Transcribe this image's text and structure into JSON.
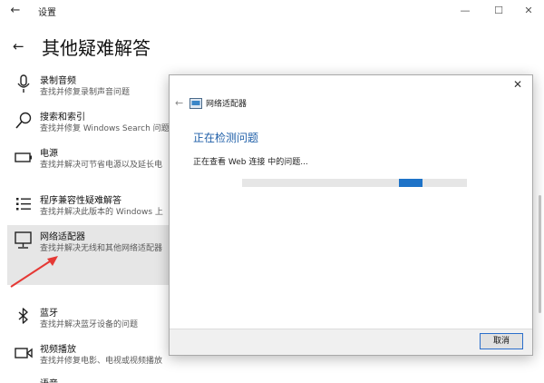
{
  "window": {
    "title": "设置",
    "back_glyph": "←",
    "min_glyph": "—",
    "max_glyph": "☐",
    "close_glyph": "✕"
  },
  "page": {
    "back_glyph": "←",
    "title": "其他疑难解答"
  },
  "tools": [
    {
      "name": "录制音频",
      "desc": "查找并修复录制声音问题",
      "icon": "microphone-icon"
    },
    {
      "name": "搜索和索引",
      "desc": "查找并修复 Windows Search 问题",
      "icon": "search-icon"
    },
    {
      "name": "电源",
      "desc": "查找并解决可节省电源以及延长电",
      "icon": "battery-icon"
    },
    {
      "name": "程序兼容性疑难解答",
      "desc": "查找并解决此版本的 Windows 上",
      "icon": "list-icon"
    },
    {
      "name": "网络适配器",
      "desc": "查找并解决无线和其他网络适配器",
      "icon": "network-adapter-icon"
    },
    {
      "name": "蓝牙",
      "desc": "查找并解决蓝牙设备的问题",
      "icon": "bluetooth-icon"
    },
    {
      "name": "视频播放",
      "desc": "查找并修复电影、电视或视频播放",
      "icon": "video-icon"
    },
    {
      "name": "语音",
      "desc": "",
      "icon": "speech-icon"
    }
  ],
  "dialog": {
    "close_glyph": "✕",
    "back_glyph": "←",
    "title": "网络适配器",
    "heading": "正在检测问题",
    "status": "正在查看 Web 连接 中的问题...",
    "progress_fraction": 0.75,
    "cancel_label": "取消"
  },
  "colors": {
    "accent": "#1e73c8",
    "heading": "#1f5fa8",
    "selected_bg": "#e6e6e6",
    "arrow": "#e53935"
  }
}
